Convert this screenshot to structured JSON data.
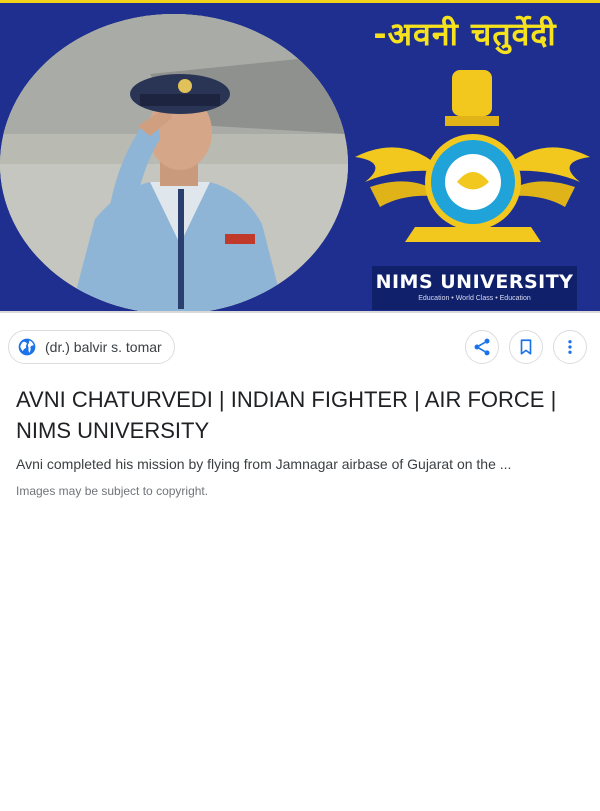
{
  "hero": {
    "hindi_name": "-अवनी चतुर्वेदी",
    "university_name": "NIMS UNIVERSITY",
    "university_tagline": "Education • World Class • Education"
  },
  "source": {
    "label": "(dr.) balvir s. tomar",
    "icon": "globe-icon"
  },
  "actions": {
    "share_icon": "share-icon",
    "save_icon": "bookmark-icon",
    "more_icon": "more-vert-icon"
  },
  "result": {
    "title": "AVNI CHATURVEDI | INDIAN FIGHTER | AIR FORCE | NIMS UNIVERSITY",
    "snippet": "Avni completed his mission by flying from Jamnagar airbase of Gujarat on the ...",
    "copyright": "Images may be subject to copyright."
  },
  "colors": {
    "hero_background": "#1e2f8f",
    "hindi_text": "#f6e31d",
    "icon_blue": "#1a73e8",
    "chip_border": "#dadce0"
  }
}
